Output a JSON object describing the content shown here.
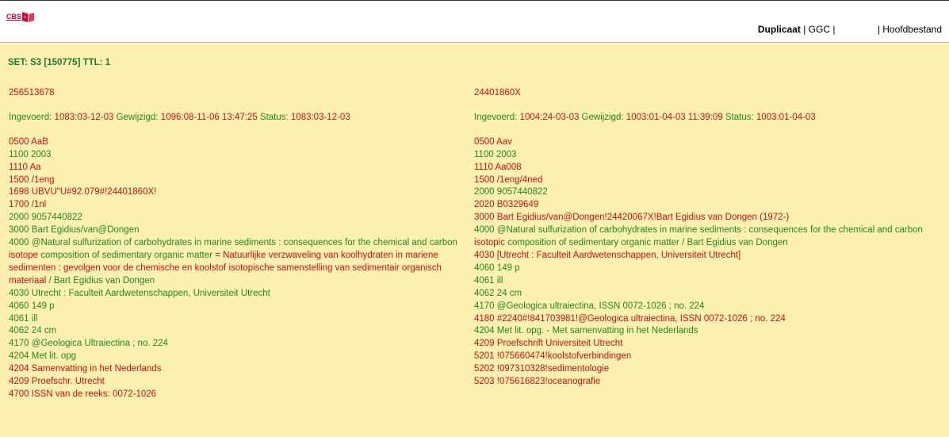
{
  "brand": {
    "logo_text": "CBS"
  },
  "nav": {
    "duplicaat": "Duplicaat",
    "sep1": " | ",
    "ggc": "GGC",
    "sep2": " |",
    "gap": "                ",
    "hoofdbestand": "| Hoofdbestand"
  },
  "colors": {
    "green": "#1e8a1e",
    "red": "#cc1111",
    "background": "#fdf0b0"
  },
  "set_line": "SET: S3 [150775] TTL: 1",
  "records": [
    {
      "id": "256513678",
      "meta": {
        "ingevoerd_label": "Ingevoerd: ",
        "ingevoerd_value": "1083:03-12-03",
        "gewijzigd_label": " Gewijzigd: ",
        "gewijzigd_value": "1096:08-11-06 13:47:25",
        "status_label": " Status: ",
        "status_value": "1083:03-12-03"
      },
      "fields": [
        {
          "code": "0500",
          "value": "AaB",
          "status": "diff"
        },
        {
          "code": "1100",
          "value": "2003",
          "status": "same"
        },
        {
          "code": "1110",
          "value": "Aa",
          "status": "diff"
        },
        {
          "code": "1500",
          "value": "/1eng",
          "status": "diff"
        },
        {
          "code": "1698",
          "value": "UBVU\"U#92.079#!24401860X!",
          "status": "diff"
        },
        {
          "code": "1700",
          "value": "/1nl",
          "status": "diff"
        },
        {
          "code": "2000",
          "value": "9057440822",
          "status": "same"
        },
        {
          "code": "3000",
          "value": "Bart Egidius/van@Dongen",
          "status": "same"
        },
        {
          "code": "4000",
          "segments": [
            {
              "text": "@Natural sulfurization of carbohydrates in marine sediments : consequences for the chemical and carbon ",
              "status": "same"
            },
            {
              "text": "isotope",
              "status": "diff"
            },
            {
              "text": " composition of sedimentary organic matter ",
              "status": "same"
            },
            {
              "text": "= Natuurlijke verzwaveling van koolhydraten in mariene sedimenten : gevolgen voor de chemische en koolstof isotopische samenstelling van sedimentair organisch materiaal",
              "status": "diff"
            },
            {
              "text": " / Bart Egidius van Dongen",
              "status": "same"
            }
          ]
        },
        {
          "code": "4030",
          "value": "Utrecht : Faculteit Aardwetenschappen, Universiteit Utrecht",
          "status": "same"
        },
        {
          "code": "4060",
          "value": "149 p",
          "status": "same"
        },
        {
          "code": "4061",
          "value": "ill",
          "status": "same"
        },
        {
          "code": "4062",
          "value": "24 cm",
          "status": "same"
        },
        {
          "code": "4170",
          "value": "@Geologica Ultraiectina ; no. 224",
          "status": "same"
        },
        {
          "code": "4204",
          "value": "Met lit. opg",
          "status": "same"
        },
        {
          "code": "4204",
          "value": "Samenvatting in het Nederlands",
          "status": "diff",
          "code_status": "diff"
        },
        {
          "code": "4209",
          "value": "Proefschr. Utrecht",
          "status": "diff"
        },
        {
          "code": "4700",
          "value": "ISSN van de reeks: 0072-1026",
          "status": "diff"
        }
      ]
    },
    {
      "id": "24401860X",
      "meta": {
        "ingevoerd_label": "Ingevoerd: ",
        "ingevoerd_value": "1004:24-03-03",
        "gewijzigd_label": " Gewijzigd: ",
        "gewijzigd_value": "1003:01-04-03 11:39:09",
        "status_label": " Status: ",
        "status_value": "1003:01-04-03"
      },
      "fields": [
        {
          "code": "0500",
          "value": "Aav",
          "status": "diff"
        },
        {
          "code": "1100",
          "value": "2003",
          "status": "same"
        },
        {
          "code": "1110",
          "value": "Aa008",
          "status": "diff"
        },
        {
          "code": "1500",
          "value": "/1eng/4ned",
          "status": "diff"
        },
        {
          "code": "2000",
          "value": "9057440822",
          "status": "same"
        },
        {
          "code": "2020",
          "value": "B0329649",
          "status": "diff"
        },
        {
          "code": "3000",
          "value": "Bart Egidius/van@Dongen!24420067X!Bart Egidius van Dongen (1972-)",
          "status": "diff"
        },
        {
          "code": "4000",
          "segments": [
            {
              "text": "@Natural sulfurization of carbohydrates in marine sediments : consequences for the chemical and carbon ",
              "status": "same"
            },
            {
              "text": "isotopic",
              "status": "diff"
            },
            {
              "text": " composition of sedimentary organic matter / Bart Egidius van Dongen",
              "status": "same"
            }
          ]
        },
        {
          "code": "4030",
          "value": "[Utrecht : Faculteit Aardwetenschappen, Universiteit Utrecht]",
          "status": "diff"
        },
        {
          "code": "4060",
          "value": "149 p",
          "status": "same"
        },
        {
          "code": "4061",
          "value": "ill",
          "status": "same"
        },
        {
          "code": "4062",
          "value": "24 cm",
          "status": "same"
        },
        {
          "code": "4170",
          "value": "@Geologica ultraiectina, ISSN 0072-1026 ; no. 224",
          "status": "same"
        },
        {
          "code": "4180",
          "value": "#2240#!841703981!@Geologica ultraiectina, ISSN 0072-1026 ; no. 224",
          "status": "diff"
        },
        {
          "code": "4204",
          "value": "Met lit. opg. - Met samenvatting in het Nederlands",
          "status": "same"
        },
        {
          "code": "4209",
          "value": "Proefschrift Universiteit Utrecht",
          "status": "diff"
        },
        {
          "code": "5201",
          "value": "!075660474!koolstofverbindingen",
          "status": "diff"
        },
        {
          "code": "5202",
          "value": "!097310328!sedimentologie",
          "status": "diff"
        },
        {
          "code": "5203",
          "value": "!075616823!oceanografie",
          "status": "diff"
        }
      ]
    }
  ]
}
